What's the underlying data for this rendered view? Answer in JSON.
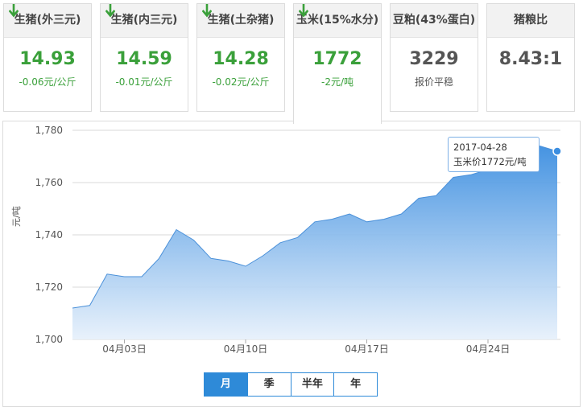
{
  "cards": [
    {
      "title": "生猪(外三元)",
      "value": "14.93",
      "change": "-0.06元/公斤",
      "trend": "down"
    },
    {
      "title": "生猪(内三元)",
      "value": "14.59",
      "change": "-0.01元/公斤",
      "trend": "down"
    },
    {
      "title": "生猪(土杂猪)",
      "value": "14.28",
      "change": "-0.02元/公斤",
      "trend": "down"
    },
    {
      "title": "玉米(15%水分)",
      "value": "1772",
      "change": "-2元/吨",
      "trend": "down",
      "active": true
    },
    {
      "title": "豆粕(43%蛋白)",
      "value": "3229",
      "change": "报价平稳",
      "trend": "flat"
    },
    {
      "title": "猪粮比",
      "value": "8.43:1",
      "change": "",
      "trend": "flat"
    }
  ],
  "colors": {
    "down": "#3aa03a",
    "accent": "#2e8ad8",
    "area_top": "#3c8ee0"
  },
  "tooltip": {
    "date": "2017-04-28",
    "text": "玉米价1772元/吨"
  },
  "range_tabs": [
    {
      "label": "月",
      "selected": true
    },
    {
      "label": "季",
      "selected": false
    },
    {
      "label": "半年",
      "selected": false
    },
    {
      "label": "年",
      "selected": false
    }
  ],
  "chart_data": {
    "type": "area",
    "ylabel": "元/吨",
    "ylim": [
      1700,
      1780
    ],
    "yticks": [
      1700,
      1720,
      1740,
      1760,
      1780
    ],
    "ytick_labels": [
      "1,700",
      "1,720",
      "1,740",
      "1,760",
      "1,780"
    ],
    "xlim": [
      "2017-03-31",
      "2017-04-28"
    ],
    "xtick_dates": [
      "2017-04-03",
      "2017-04-10",
      "2017-04-17",
      "2017-04-24"
    ],
    "xtick_labels": [
      "04月03日",
      "04月10日",
      "04月17日",
      "04月24日"
    ],
    "x": [
      "2017-03-31",
      "2017-04-01",
      "2017-04-02",
      "2017-04-03",
      "2017-04-04",
      "2017-04-05",
      "2017-04-06",
      "2017-04-07",
      "2017-04-08",
      "2017-04-09",
      "2017-04-10",
      "2017-04-11",
      "2017-04-12",
      "2017-04-13",
      "2017-04-14",
      "2017-04-15",
      "2017-04-16",
      "2017-04-17",
      "2017-04-18",
      "2017-04-19",
      "2017-04-20",
      "2017-04-21",
      "2017-04-22",
      "2017-04-23",
      "2017-04-24",
      "2017-04-25",
      "2017-04-26",
      "2017-04-27",
      "2017-04-28"
    ],
    "values": [
      1712,
      1713,
      1725,
      1724,
      1724,
      1731,
      1742,
      1738,
      1731,
      1730,
      1728,
      1732,
      1737,
      1739,
      1745,
      1746,
      1748,
      1745,
      1746,
      1748,
      1754,
      1755,
      1762,
      1763,
      1765,
      1767,
      1769,
      1774,
      1772
    ],
    "grid": true,
    "legend": "none"
  }
}
